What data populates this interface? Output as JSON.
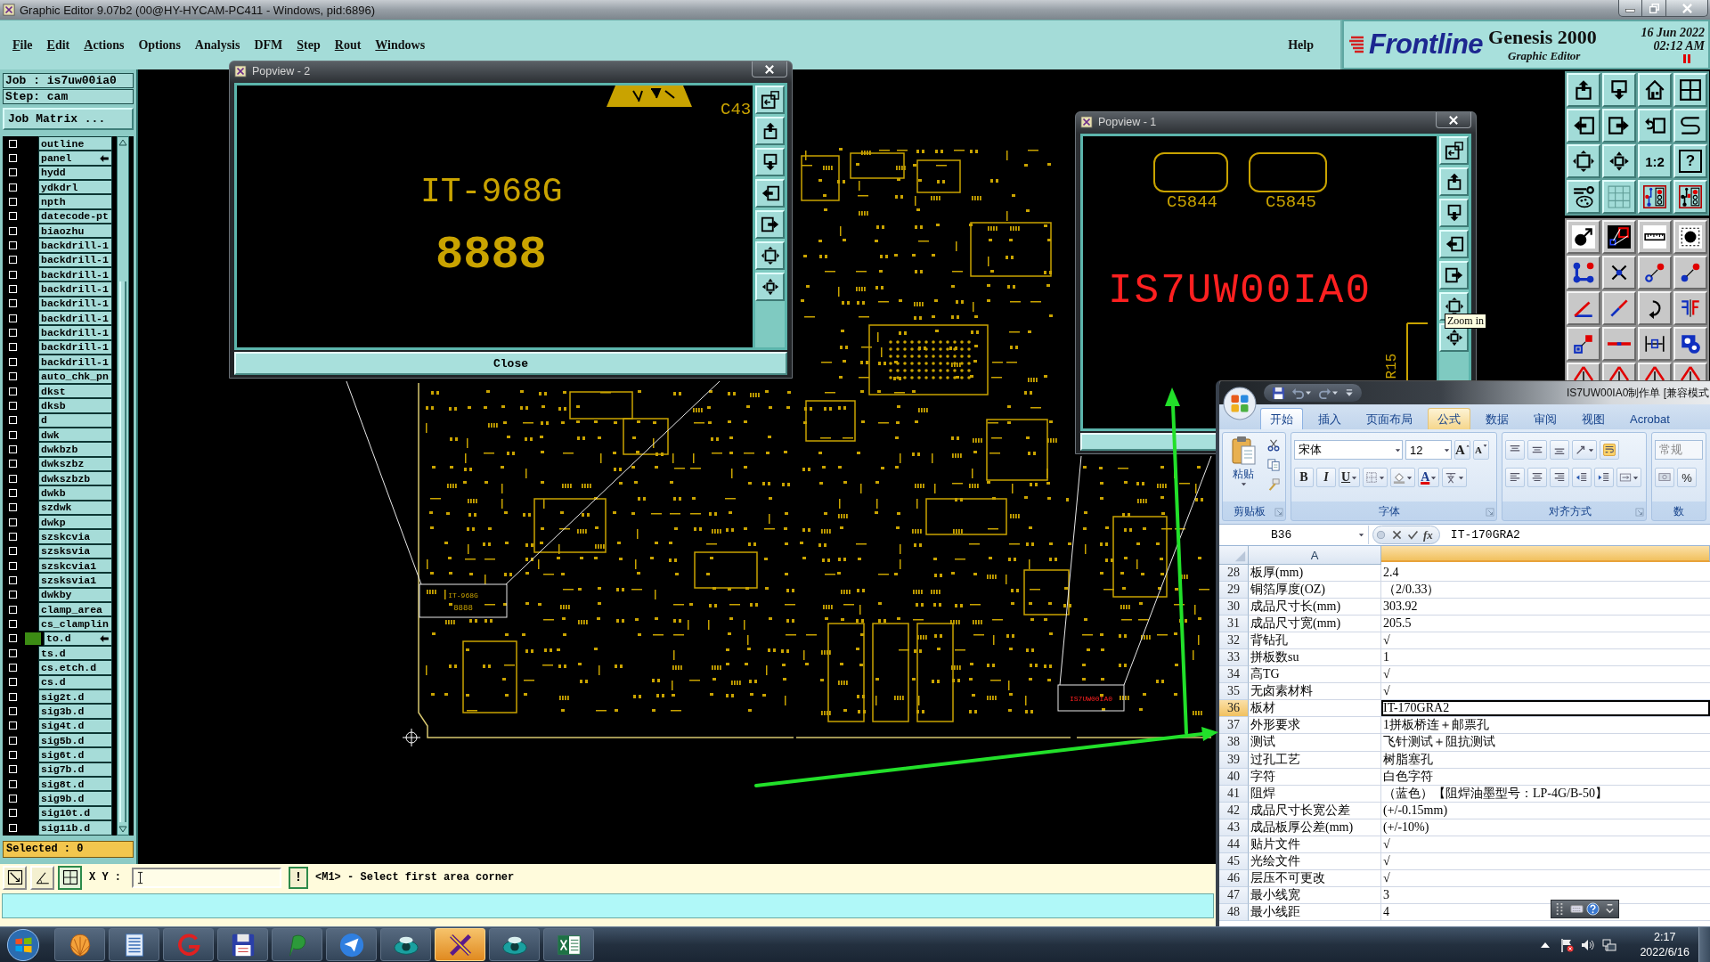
{
  "window": {
    "title": "Graphic Editor 9.07b2 (00@HY-HYCAM-PC411 - Windows, pid:6896)"
  },
  "menu": [
    {
      "label": "File",
      "mnemonic": true
    },
    {
      "label": "Edit",
      "mnemonic": true
    },
    {
      "label": "Actions",
      "mnemonic": true
    },
    {
      "label": "Options",
      "mnemonic": false
    },
    {
      "label": "Analysis",
      "mnemonic": false
    },
    {
      "label": "DFM",
      "mnemonic": false
    },
    {
      "label": "Step",
      "mnemonic": true
    },
    {
      "label": "Rout",
      "mnemonic": true
    },
    {
      "label": "Windows",
      "mnemonic": true
    }
  ],
  "help_menu": {
    "label": "Help",
    "mnemonic": false
  },
  "brand": {
    "logo": "Frontline",
    "product": "Genesis 2000",
    "subtitle": "Graphic Editor",
    "date": "16 Jun 2022",
    "time": "02:12 AM"
  },
  "job_panel": {
    "job": "Job : is7uw00ia0",
    "step": "Step: cam",
    "matrix_button": "Job Matrix ...",
    "layers": [
      {
        "name": "outline",
        "checked": false,
        "work": false,
        "marked": false
      },
      {
        "name": "panel",
        "checked": false,
        "work": false,
        "marked": true
      },
      {
        "name": "hydd",
        "checked": false,
        "work": false,
        "marked": false
      },
      {
        "name": "ydkdrl",
        "checked": false,
        "work": false,
        "marked": false
      },
      {
        "name": "npth",
        "checked": false,
        "work": false,
        "marked": false
      },
      {
        "name": "datecode-pt",
        "checked": false,
        "work": false,
        "marked": false
      },
      {
        "name": "biaozhu",
        "checked": false,
        "work": false,
        "marked": false
      },
      {
        "name": "backdrill-1",
        "checked": false,
        "work": false,
        "marked": false
      },
      {
        "name": "backdrill-1",
        "checked": false,
        "work": false,
        "marked": false
      },
      {
        "name": "backdrill-1",
        "checked": false,
        "work": false,
        "marked": false
      },
      {
        "name": "backdrill-1",
        "checked": false,
        "work": false,
        "marked": false
      },
      {
        "name": "backdrill-1",
        "checked": false,
        "work": false,
        "marked": false
      },
      {
        "name": "backdrill-1",
        "checked": false,
        "work": false,
        "marked": false
      },
      {
        "name": "backdrill-1",
        "checked": false,
        "work": false,
        "marked": false
      },
      {
        "name": "backdrill-1",
        "checked": false,
        "work": false,
        "marked": false
      },
      {
        "name": "backdrill-1",
        "checked": false,
        "work": false,
        "marked": false
      },
      {
        "name": "auto_chk_pn",
        "checked": false,
        "work": false,
        "marked": false
      },
      {
        "name": "dkst",
        "checked": false,
        "work": false,
        "marked": false
      },
      {
        "name": "dksb",
        "checked": false,
        "work": false,
        "marked": false
      },
      {
        "name": "d",
        "checked": false,
        "work": false,
        "marked": false
      },
      {
        "name": "dwk",
        "checked": false,
        "work": false,
        "marked": false
      },
      {
        "name": "dwkbzb",
        "checked": false,
        "work": false,
        "marked": false
      },
      {
        "name": "dwkszbz",
        "checked": false,
        "work": false,
        "marked": false
      },
      {
        "name": "dwkszbzb",
        "checked": false,
        "work": false,
        "marked": false
      },
      {
        "name": "dwkb",
        "checked": false,
        "work": false,
        "marked": false
      },
      {
        "name": "szdwk",
        "checked": false,
        "work": false,
        "marked": false
      },
      {
        "name": "dwkp",
        "checked": false,
        "work": false,
        "marked": false
      },
      {
        "name": "szskcvia",
        "checked": false,
        "work": false,
        "marked": false
      },
      {
        "name": "szsksvia",
        "checked": false,
        "work": false,
        "marked": false
      },
      {
        "name": "szskcvia1",
        "checked": false,
        "work": false,
        "marked": false
      },
      {
        "name": "szsksvia1",
        "checked": false,
        "work": false,
        "marked": false
      },
      {
        "name": "dwkby",
        "checked": false,
        "work": false,
        "marked": false
      },
      {
        "name": "clamp_area",
        "checked": false,
        "work": false,
        "marked": false
      },
      {
        "name": "cs_clamplin",
        "checked": false,
        "work": false,
        "marked": false
      },
      {
        "name": "to.d",
        "checked": false,
        "work": true,
        "marked": true
      },
      {
        "name": "ts.d",
        "checked": false,
        "work": false,
        "marked": false
      },
      {
        "name": "cs.etch.d",
        "checked": false,
        "work": false,
        "marked": false
      },
      {
        "name": "cs.d",
        "checked": false,
        "work": false,
        "marked": false
      },
      {
        "name": "sig2t.d",
        "checked": false,
        "work": false,
        "marked": false
      },
      {
        "name": "sig3b.d",
        "checked": false,
        "work": false,
        "marked": false
      },
      {
        "name": "sig4t.d",
        "checked": false,
        "work": false,
        "marked": false
      },
      {
        "name": "sig5b.d",
        "checked": false,
        "work": false,
        "marked": false
      },
      {
        "name": "sig6t.d",
        "checked": false,
        "work": false,
        "marked": false
      },
      {
        "name": "sig7b.d",
        "checked": false,
        "work": false,
        "marked": false
      },
      {
        "name": "sig8t.d",
        "checked": false,
        "work": false,
        "marked": false
      },
      {
        "name": "sig9b.d",
        "checked": false,
        "work": false,
        "marked": false
      },
      {
        "name": "sig10t.d",
        "checked": false,
        "work": false,
        "marked": false
      },
      {
        "name": "sig11b.d",
        "checked": false,
        "work": false,
        "marked": false
      }
    ],
    "selected_count": "Selected : 0"
  },
  "toolbar": {
    "top": [
      {
        "kind": "tray-up"
      },
      {
        "kind": "tray-down"
      },
      {
        "kind": "home"
      },
      {
        "kind": "panes"
      },
      {
        "kind": "in-left"
      },
      {
        "kind": "out-right"
      },
      {
        "kind": "undo-box"
      },
      {
        "kind": "s-curve"
      },
      {
        "kind": "fit"
      },
      {
        "kind": "center"
      },
      {
        "kind": "text",
        "label": "1:2"
      },
      {
        "kind": "boxed-text",
        "label": "?"
      },
      {
        "kind": "palette"
      },
      {
        "kind": "grid"
      },
      {
        "kind": "layers"
      },
      {
        "kind": "layers-2"
      }
    ],
    "bottom": [
      {
        "kind": "circle-arrow"
      },
      {
        "kind": "box-select"
      },
      {
        "kind": "ruler"
      },
      {
        "kind": "pad"
      },
      {
        "kind": "nodes"
      },
      {
        "kind": "x-mark"
      },
      {
        "kind": "link-open"
      },
      {
        "kind": "link"
      },
      {
        "kind": "angle"
      },
      {
        "kind": "diagonal"
      },
      {
        "kind": "rotate"
      },
      {
        "kind": "mirror"
      },
      {
        "kind": "move-square"
      },
      {
        "kind": "red-line"
      },
      {
        "kind": "dimension"
      },
      {
        "kind": "shapes"
      },
      {
        "kind": "peak"
      },
      {
        "kind": "peak"
      },
      {
        "kind": "peak"
      },
      {
        "kind": "peak"
      }
    ]
  },
  "board_labels": {
    "part_number": "IT-968G",
    "date_code": "8888",
    "job_marking": "IS7UW00IA0"
  },
  "popview_2": {
    "title": "Popview - 2",
    "close_button": "Close",
    "tools": [
      {
        "kind": "window-sync"
      },
      {
        "kind": "tray-up"
      },
      {
        "kind": "tray-down"
      },
      {
        "kind": "in-left"
      },
      {
        "kind": "out-right"
      },
      {
        "kind": "fit"
      },
      {
        "kind": "center"
      }
    ],
    "part_number": "IT-968G",
    "date_code": "8888",
    "ref": "C43"
  },
  "popview_1": {
    "title": "Popview - 1",
    "tools": [
      {
        "kind": "window-sync"
      },
      {
        "kind": "tray-up"
      },
      {
        "kind": "tray-down"
      },
      {
        "kind": "in-left"
      },
      {
        "kind": "out-right"
      },
      {
        "kind": "fit"
      },
      {
        "kind": "center"
      }
    ],
    "refs": [
      "C5844",
      "C5845"
    ],
    "job_marking": "IS7UW00IA0",
    "side_ref": "R15"
  },
  "tooltip": {
    "text": "Zoom in"
  },
  "status_bar": {
    "tools": [
      {
        "kind": "diag-box",
        "selected": false
      },
      {
        "kind": "angle-box",
        "selected": false
      },
      {
        "kind": "grid-box",
        "selected": true
      }
    ],
    "coord_label": "X Y :",
    "alert_button": "!",
    "prompt": "<M1> - Select first area corner"
  },
  "excel": {
    "title": "IS7UW00IA0制作单  [兼容模式",
    "tabs": [
      {
        "label": "开始",
        "selected": true,
        "hovered": false
      },
      {
        "label": "插入",
        "selected": false,
        "hovered": false
      },
      {
        "label": "页面布局",
        "selected": false,
        "hovered": false
      },
      {
        "label": "公式",
        "selected": false,
        "hovered": true
      },
      {
        "label": "数据",
        "selected": false,
        "hovered": false
      },
      {
        "label": "审阅",
        "selected": false,
        "hovered": false
      },
      {
        "label": "视图",
        "selected": false,
        "hovered": false
      },
      {
        "label": "Acrobat",
        "selected": false,
        "hovered": false
      }
    ],
    "ribbon": {
      "paste": "粘贴",
      "font_name": "宋体",
      "font_size": "12",
      "grow_font": "A",
      "shrink_font": "A",
      "bold": "B",
      "italic": "I",
      "underline": "U",
      "font_color": "A",
      "number_format": "常规",
      "percent": "%",
      "groups": [
        "剪贴板",
        "字体",
        "对齐方式",
        "数"
      ]
    },
    "name_box": "B36",
    "function_button": "fx",
    "formula": "IT-170GRA2",
    "columns": [
      {
        "label": "A",
        "selected": false
      },
      {
        "selected": true
      }
    ],
    "rows": [
      {
        "number": "28",
        "label": "板厚(mm)",
        "value": "2.4",
        "selected": false
      },
      {
        "number": "29",
        "label": "铜箔厚度(OZ)",
        "value": "（2/0.33）",
        "selected": false
      },
      {
        "number": "30",
        "label": "成品尺寸长(mm)",
        "value": "303.92",
        "selected": false
      },
      {
        "number": "31",
        "label": "成品尺寸宽(mm)",
        "value": "205.5",
        "selected": false
      },
      {
        "number": "32",
        "label": "背钻孔",
        "value": "√",
        "selected": false
      },
      {
        "number": "33",
        "label": "拼板数su",
        "value": "1",
        "selected": false
      },
      {
        "number": "34",
        "label": "高TG",
        "value": "√",
        "selected": false
      },
      {
        "number": "35",
        "label": "无卤素材料",
        "value": "√",
        "selected": false
      },
      {
        "number": "36",
        "label": "板材",
        "value": "IT-170GRA2",
        "selected": true
      },
      {
        "number": "37",
        "label": "外形要求",
        "value": "1拼板桥连＋邮票孔",
        "selected": false
      },
      {
        "number": "38",
        "label": "测试",
        "value": "飞针测试＋阻抗测试",
        "selected": false
      },
      {
        "number": "39",
        "label": "过孔工艺",
        "value": "树脂塞孔",
        "selected": false
      },
      {
        "number": "40",
        "label": "字符",
        "value": "白色字符",
        "selected": false
      },
      {
        "number": "41",
        "label": "阻焊",
        "value": "（蓝色）【阻焊油墨型号：LP-4G/B-50】",
        "selected": false
      },
      {
        "number": "42",
        "label": "成品尺寸长宽公差",
        "value": "(+/-0.15mm)",
        "selected": false
      },
      {
        "number": "43",
        "label": "成品板厚公差(mm)",
        "value": "(+/-10%)",
        "selected": false
      },
      {
        "number": "44",
        "label": "贴片文件",
        "value": "√",
        "selected": false
      },
      {
        "number": "45",
        "label": "光绘文件",
        "value": "√",
        "selected": false
      },
      {
        "number": "46",
        "label": "层压不可更改",
        "value": "√",
        "selected": false
      },
      {
        "number": "47",
        "label": "最小线宽",
        "value": "3",
        "selected": false
      },
      {
        "number": "48",
        "label": "最小线距",
        "value": "4",
        "selected": false
      }
    ]
  },
  "taskbar": {
    "apps": [
      {
        "kind": "shell",
        "selected": false
      },
      {
        "kind": "notepad",
        "selected": false
      },
      {
        "kind": "swirl",
        "selected": false
      },
      {
        "kind": "floppy",
        "selected": false
      },
      {
        "kind": "leaf",
        "selected": false
      },
      {
        "kind": "plane",
        "selected": false
      },
      {
        "kind": "eye",
        "selected": false
      },
      {
        "kind": "x-app",
        "selected": true
      },
      {
        "kind": "eye",
        "selected": false
      },
      {
        "kind": "excel",
        "selected": false
      }
    ],
    "time": "2:17",
    "date": "2022/6/16"
  }
}
